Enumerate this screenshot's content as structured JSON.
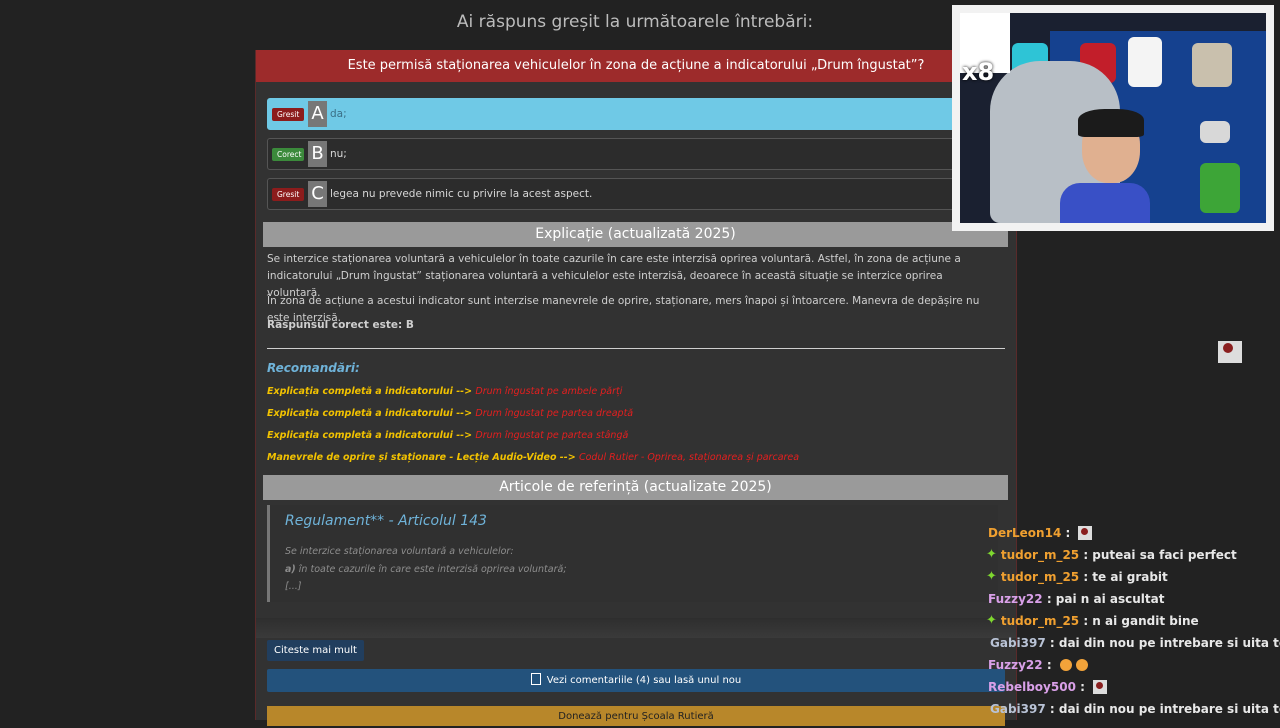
{
  "page": {
    "heading": "Ai răspuns greșit la următoarele întrebări:"
  },
  "question": {
    "text": "Este permisă staționarea vehiculelor în zona de acțiune a indicatorului „Drum îngustat”?",
    "answers": [
      {
        "badge": "Gresit",
        "status": "wrong",
        "letter": "A",
        "text": "da;",
        "selected": true
      },
      {
        "badge": "Corect",
        "status": "right",
        "letter": "B",
        "text": "nu;",
        "selected": false
      },
      {
        "badge": "Gresit",
        "status": "wrong",
        "letter": "C",
        "text": "legea nu prevede nimic cu privire la acest aspect.",
        "selected": false
      }
    ]
  },
  "explanation": {
    "title": "Explicație (actualizată 2025)",
    "paragraph1": "Se interzice staționarea voluntară a vehiculelor în toate cazurile în care este interzisă oprirea voluntară. Astfel, în zona de acțiune a indicatorului „Drum îngustat” staționarea voluntară a vehiculelor este interzisă, deoarece în această situație se interzice oprirea voluntară.",
    "paragraph2": "În zona de acțiune a acestui indicator sunt interzise manevrele de oprire, staționare, mers înapoi și întoarcere. Manevra de depășire nu este interzisă.",
    "correct": "Răspunsul corect este: B"
  },
  "recommendations": {
    "title": "Recomandări:",
    "items": [
      {
        "prefix": "Explicația completă a indicatorului -->",
        "link": "Drum îngustat pe ambele părți"
      },
      {
        "prefix": "Explicația completă a indicatorului -->",
        "link": "Drum îngustat pe partea dreaptă"
      },
      {
        "prefix": "Explicația completă a indicatorului -->",
        "link": "Drum îngustat pe partea stângă"
      },
      {
        "prefix": "Manevrele de oprire și staționare - Lecție Audio-Video -->",
        "link": "Codul Rutier - Oprirea, staționarea și parcarea"
      }
    ]
  },
  "articles": {
    "title": "Articole de referință (actualizate 2025)",
    "quote_title": "Regulament** - Articolul 143",
    "line1": "Se interzice staționarea voluntară a vehiculelor:",
    "line2_bold": "a)",
    "line2": " în toate cazurile în care este interzisă oprirea voluntară;",
    "line3": "[...]",
    "more_button": "Citeste mai mult",
    "comments": "Vezi comentariile (4) sau lasă unul nou",
    "donate": "Donează pentru Școala Rutieră"
  },
  "webcam": {
    "multiplier": "x8"
  },
  "chat": [
    {
      "user": "DerLeon14",
      "color": "#f0a030",
      "badge": "none",
      "message": "",
      "avatar": true
    },
    {
      "user": "tudor_m_25",
      "color": "#f0a030",
      "badge": "star",
      "message": "puteai sa faci perfect"
    },
    {
      "user": "tudor_m_25",
      "color": "#f0a030",
      "badge": "star",
      "message": "te ai grabit"
    },
    {
      "user": "Fuzzy22",
      "color": "#d9a0e8",
      "badge": "none",
      "message": "pai n ai ascultat"
    },
    {
      "user": "tudor_m_25",
      "color": "#f0a030",
      "badge": "star",
      "message": "n ai gandit bine"
    },
    {
      "user": "Gabi397",
      "color": "#b9c3d6",
      "badge": "sub",
      "message": "dai din nou pe intrebare si uita te la c"
    },
    {
      "user": "Fuzzy22",
      "color": "#d9a0e8",
      "badge": "none",
      "message": "",
      "emoji": true
    },
    {
      "user": "Rebelboy500",
      "color": "#d9a0e8",
      "badge": "none",
      "message": "",
      "avatar": true
    },
    {
      "user": "Gabi397",
      "color": "#b9c3d6",
      "badge": "sub",
      "message": "dai din nou pe intrebare si uita te la c"
    }
  ]
}
